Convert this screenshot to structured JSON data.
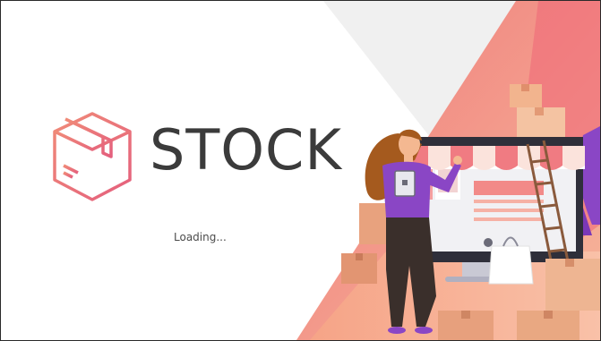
{
  "app": {
    "title": "STOCK"
  },
  "status": {
    "loading_text": "Loading..."
  },
  "colors": {
    "brand_text": "#3b3b3b",
    "accent_red": "#e85a6a",
    "accent_peach": "#f7b08a",
    "logo_gradient_start": "#f08b78",
    "logo_gradient_end": "#e45f7d",
    "purple": "#8a46c5"
  },
  "icons": {
    "logo": "box-icon"
  }
}
